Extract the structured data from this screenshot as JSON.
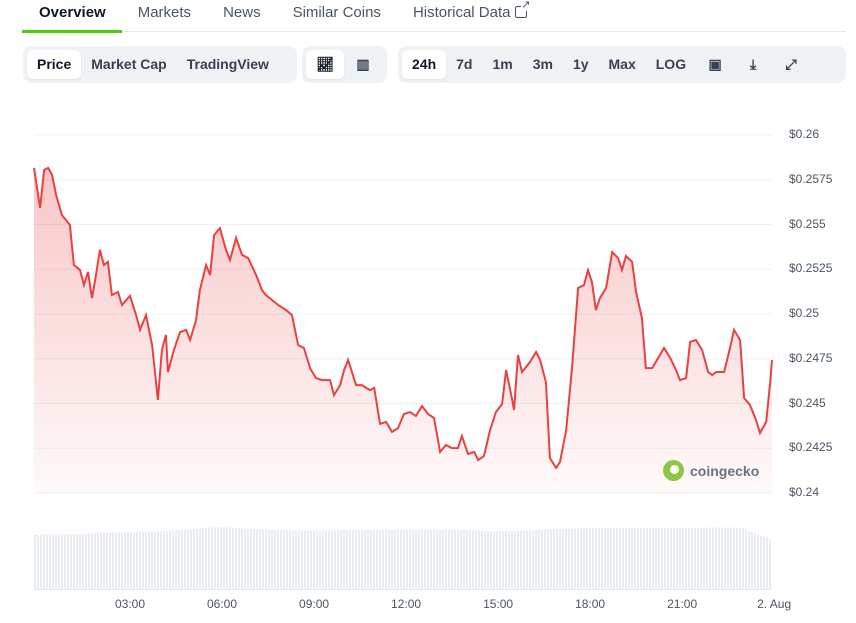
{
  "tabs": [
    "Overview",
    "Markets",
    "News",
    "Similar Coins",
    "Historical Data"
  ],
  "chart_type_buttons": [
    "Price",
    "Market Cap",
    "TradingView"
  ],
  "range_buttons": [
    "24h",
    "7d",
    "1m",
    "3m",
    "1y",
    "Max",
    "LOG"
  ],
  "accent": "#4bcc00",
  "line_color": "#e84142",
  "chart_data": {
    "type": "area",
    "y_ticks": [
      "$0.26",
      "$0.2575",
      "$0.255",
      "$0.2525",
      "$0.25",
      "$0.2475",
      "$0.245",
      "$0.2425",
      "$0.24"
    ],
    "ylim": [
      0.24,
      0.26
    ],
    "x_ticks": [
      "03:00",
      "06:00",
      "09:00",
      "12:00",
      "15:00",
      "18:00",
      "21:00",
      "2. Aug"
    ],
    "x_tick_hours": [
      3,
      6,
      9,
      12,
      15,
      18,
      21,
      24
    ],
    "xlim_hours": [
      -0.13,
      23.93
    ],
    "points": [
      [
        -0.13,
        0.25816
      ],
      [
        0.07,
        0.25592
      ],
      [
        0.2,
        0.25804
      ],
      [
        0.33,
        0.25816
      ],
      [
        0.46,
        0.25777
      ],
      [
        0.59,
        0.25665
      ],
      [
        0.78,
        0.25553
      ],
      [
        1.04,
        0.25497
      ],
      [
        1.17,
        0.25274
      ],
      [
        1.37,
        0.25246
      ],
      [
        1.5,
        0.25162
      ],
      [
        1.63,
        0.25235
      ],
      [
        1.76,
        0.25089
      ],
      [
        1.89,
        0.25218
      ],
      [
        2.02,
        0.25358
      ],
      [
        2.15,
        0.25274
      ],
      [
        2.28,
        0.25291
      ],
      [
        2.41,
        0.25106
      ],
      [
        2.61,
        0.25123
      ],
      [
        2.74,
        0.2505
      ],
      [
        3.0,
        0.25101
      ],
      [
        3.2,
        0.24994
      ],
      [
        3.33,
        0.24911
      ],
      [
        3.52,
        0.24994
      ],
      [
        3.72,
        0.24827
      ],
      [
        3.91,
        0.2452
      ],
      [
        4.04,
        0.24799
      ],
      [
        4.17,
        0.24883
      ],
      [
        4.24,
        0.24676
      ],
      [
        4.43,
        0.24799
      ],
      [
        4.63,
        0.24899
      ],
      [
        4.83,
        0.24911
      ],
      [
        4.96,
        0.24855
      ],
      [
        5.15,
        0.24966
      ],
      [
        5.28,
        0.25134
      ],
      [
        5.48,
        0.25274
      ],
      [
        5.61,
        0.25218
      ],
      [
        5.74,
        0.25441
      ],
      [
        5.93,
        0.2548
      ],
      [
        6.13,
        0.25358
      ],
      [
        6.26,
        0.25302
      ],
      [
        6.46,
        0.25425
      ],
      [
        6.65,
        0.2533
      ],
      [
        6.85,
        0.25313
      ],
      [
        7.11,
        0.25218
      ],
      [
        7.3,
        0.25134
      ],
      [
        7.43,
        0.25106
      ],
      [
        7.63,
        0.25078
      ],
      [
        7.83,
        0.2505
      ],
      [
        8.09,
        0.25022
      ],
      [
        8.28,
        0.24994
      ],
      [
        8.48,
        0.24827
      ],
      [
        8.67,
        0.2481
      ],
      [
        8.87,
        0.24698
      ],
      [
        9.06,
        0.24642
      ],
      [
        9.26,
        0.24631
      ],
      [
        9.52,
        0.24631
      ],
      [
        9.65,
        0.24547
      ],
      [
        9.85,
        0.24603
      ],
      [
        9.98,
        0.24687
      ],
      [
        10.11,
        0.24743
      ],
      [
        10.37,
        0.24603
      ],
      [
        10.56,
        0.24603
      ],
      [
        10.82,
        0.24575
      ],
      [
        10.96,
        0.24587
      ],
      [
        11.15,
        0.24386
      ],
      [
        11.35,
        0.24397
      ],
      [
        11.54,
        0.24341
      ],
      [
        11.74,
        0.24363
      ],
      [
        11.93,
        0.24441
      ],
      [
        12.13,
        0.24452
      ],
      [
        12.32,
        0.2443
      ],
      [
        12.52,
        0.24486
      ],
      [
        12.72,
        0.24441
      ],
      [
        12.91,
        0.24419
      ],
      [
        13.11,
        0.24229
      ],
      [
        13.3,
        0.24268
      ],
      [
        13.5,
        0.24251
      ],
      [
        13.69,
        0.24251
      ],
      [
        13.82,
        0.24318
      ],
      [
        14.02,
        0.24218
      ],
      [
        14.22,
        0.24229
      ],
      [
        14.35,
        0.24184
      ],
      [
        14.54,
        0.24207
      ],
      [
        14.74,
        0.24352
      ],
      [
        14.93,
        0.24452
      ],
      [
        15.13,
        0.24497
      ],
      [
        15.26,
        0.24687
      ],
      [
        15.46,
        0.2452
      ],
      [
        15.52,
        0.24464
      ],
      [
        15.65,
        0.24771
      ],
      [
        15.78,
        0.24676
      ],
      [
        16.04,
        0.24732
      ],
      [
        16.24,
        0.24788
      ],
      [
        16.37,
        0.24743
      ],
      [
        16.56,
        0.2462
      ],
      [
        16.69,
        0.24196
      ],
      [
        16.89,
        0.2414
      ],
      [
        17.02,
        0.24173
      ],
      [
        17.22,
        0.24352
      ],
      [
        17.41,
        0.24698
      ],
      [
        17.61,
        0.25145
      ],
      [
        17.8,
        0.25162
      ],
      [
        17.93,
        0.25246
      ],
      [
        18.06,
        0.25179
      ],
      [
        18.19,
        0.25022
      ],
      [
        18.32,
        0.25089
      ],
      [
        18.52,
        0.25145
      ],
      [
        18.72,
        0.25346
      ],
      [
        18.91,
        0.25313
      ],
      [
        19.04,
        0.25246
      ],
      [
        19.17,
        0.25324
      ],
      [
        19.37,
        0.25291
      ],
      [
        19.5,
        0.25123
      ],
      [
        19.69,
        0.24978
      ],
      [
        19.82,
        0.24698
      ],
      [
        20.02,
        0.24698
      ],
      [
        20.28,
        0.24771
      ],
      [
        20.41,
        0.2481
      ],
      [
        20.61,
        0.24754
      ],
      [
        20.8,
        0.24687
      ],
      [
        20.93,
        0.24631
      ],
      [
        21.13,
        0.24642
      ],
      [
        21.26,
        0.24844
      ],
      [
        21.45,
        0.24855
      ],
      [
        21.65,
        0.24799
      ],
      [
        21.85,
        0.24676
      ],
      [
        21.98,
        0.24659
      ],
      [
        22.11,
        0.24676
      ],
      [
        22.37,
        0.24676
      ],
      [
        22.56,
        0.2481
      ],
      [
        22.69,
        0.24911
      ],
      [
        22.89,
        0.24855
      ],
      [
        23.02,
        0.24531
      ],
      [
        23.21,
        0.24492
      ],
      [
        23.41,
        0.24408
      ],
      [
        23.54,
        0.24335
      ],
      [
        23.74,
        0.24397
      ],
      [
        23.87,
        0.2462
      ],
      [
        23.93,
        0.24743
      ]
    ],
    "volume_relative": [
      0.88,
      0.88,
      0.9,
      0.92,
      0.93,
      0.96,
      1.0,
      0.97,
      0.95,
      0.94,
      0.95,
      0.95,
      0.96,
      0.96,
      0.95,
      0.93,
      0.94,
      0.97,
      0.98,
      0.98,
      0.98,
      0.98,
      0.99,
      0.99,
      0.8
    ]
  },
  "watermark": "coingecko"
}
